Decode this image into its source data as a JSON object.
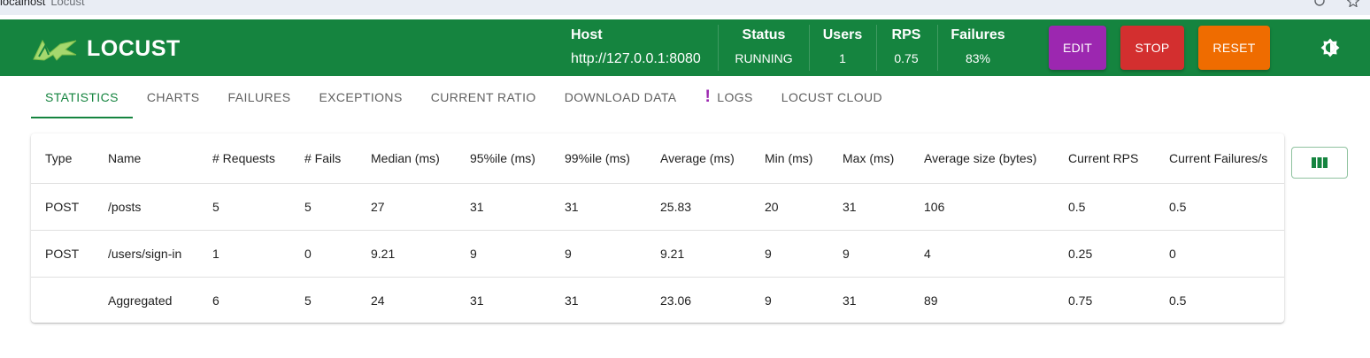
{
  "browser": {
    "url_host": "localhost",
    "tab_title": "Locust"
  },
  "header": {
    "brand": "LOCUST",
    "host_label": "Host",
    "host_value": "http://127.0.0.1:8080",
    "status_label": "Status",
    "status_value": "RUNNING",
    "users_label": "Users",
    "users_value": "1",
    "rps_label": "RPS",
    "rps_value": "0.75",
    "failures_label": "Failures",
    "failures_value": "83%",
    "edit_label": "EDIT",
    "stop_label": "STOP",
    "reset_label": "RESET",
    "theme_icon": "brightness-icon"
  },
  "tabs": [
    {
      "label": "STATISTICS"
    },
    {
      "label": "CHARTS"
    },
    {
      "label": "FAILURES"
    },
    {
      "label": "EXCEPTIONS"
    },
    {
      "label": "CURRENT RATIO"
    },
    {
      "label": "DOWNLOAD DATA"
    },
    {
      "label": "LOGS",
      "alert": "!"
    },
    {
      "label": "LOCUST CLOUD"
    }
  ],
  "table": {
    "columns": [
      "Type",
      "Name",
      "# Requests",
      "# Fails",
      "Median (ms)",
      "95%ile (ms)",
      "99%ile (ms)",
      "Average (ms)",
      "Min (ms)",
      "Max (ms)",
      "Average size (bytes)",
      "Current RPS",
      "Current Failures/s"
    ],
    "rows": [
      [
        "POST",
        "/posts",
        "5",
        "5",
        "27",
        "31",
        "31",
        "25.83",
        "20",
        "31",
        "106",
        "0.5",
        "0.5"
      ],
      [
        "POST",
        "/users/sign-in",
        "1",
        "0",
        "9.21",
        "9",
        "9",
        "9.21",
        "9",
        "9",
        "4",
        "0.25",
        "0"
      ],
      [
        "",
        "Aggregated",
        "6",
        "5",
        "24",
        "31",
        "31",
        "23.06",
        "9",
        "31",
        "89",
        "0.75",
        "0.5"
      ]
    ]
  },
  "colors": {
    "header_bg": "#15843f",
    "edit": "#9c27b0",
    "stop": "#d32f2f",
    "reset": "#ef6c00",
    "logo_accent": "#a5d86e"
  }
}
